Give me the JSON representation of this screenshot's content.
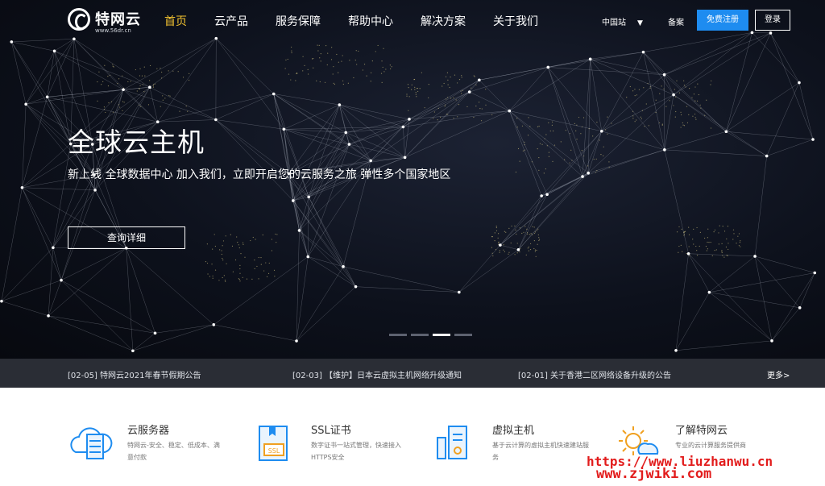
{
  "brand": {
    "name": "特网云",
    "url": "www.56dr.cn"
  },
  "nav": {
    "items": [
      "首页",
      "云产品",
      "服务保障",
      "帮助中心",
      "解决方案",
      "关于我们"
    ],
    "active_index": 0,
    "site_select": "中国站",
    "beian": "备案",
    "register_label": "免费注册",
    "login_label": "登录"
  },
  "hero": {
    "title": "全球云主机",
    "subtitle": "新上线 全球数据中心 加入我们，立即开启您的云服务之旅 弹性多个国家地区",
    "button_label": "查询详细",
    "slide_count": 4,
    "active_slide": 2
  },
  "news": {
    "items": [
      "[02-05] 特网云2021年春节假期公告",
      "[02-03] 【维护】日本云虚拟主机网络升级通知",
      "[02-01] 关于香港二区网络设备升级的公告"
    ],
    "more_label": "更多>"
  },
  "features": [
    {
      "icon": "cloud-server-icon",
      "title": "云服务器",
      "desc": "特网云-安全、稳定、低成本、满意付款"
    },
    {
      "icon": "ssl-certificate-icon",
      "title": "SSL证书",
      "desc": "数字证书一站式管理，快速接入HTTPS安全"
    },
    {
      "icon": "virtual-host-icon",
      "title": "虚拟主机",
      "desc": "基于云计算的虚拟主机快速建站服务"
    },
    {
      "icon": "about-sun-icon",
      "title": "了解特网云",
      "desc": "专业的云计算服务提供商"
    }
  ],
  "watermark": {
    "line1": "https://www.liuzhanwu.cn",
    "line2": "www.zjwiki.com"
  },
  "colors": {
    "accent": "#1e8cf0",
    "active_nav": "#f2c230",
    "news_bar": "#2a2d35",
    "watermark": "#e21c1c"
  }
}
